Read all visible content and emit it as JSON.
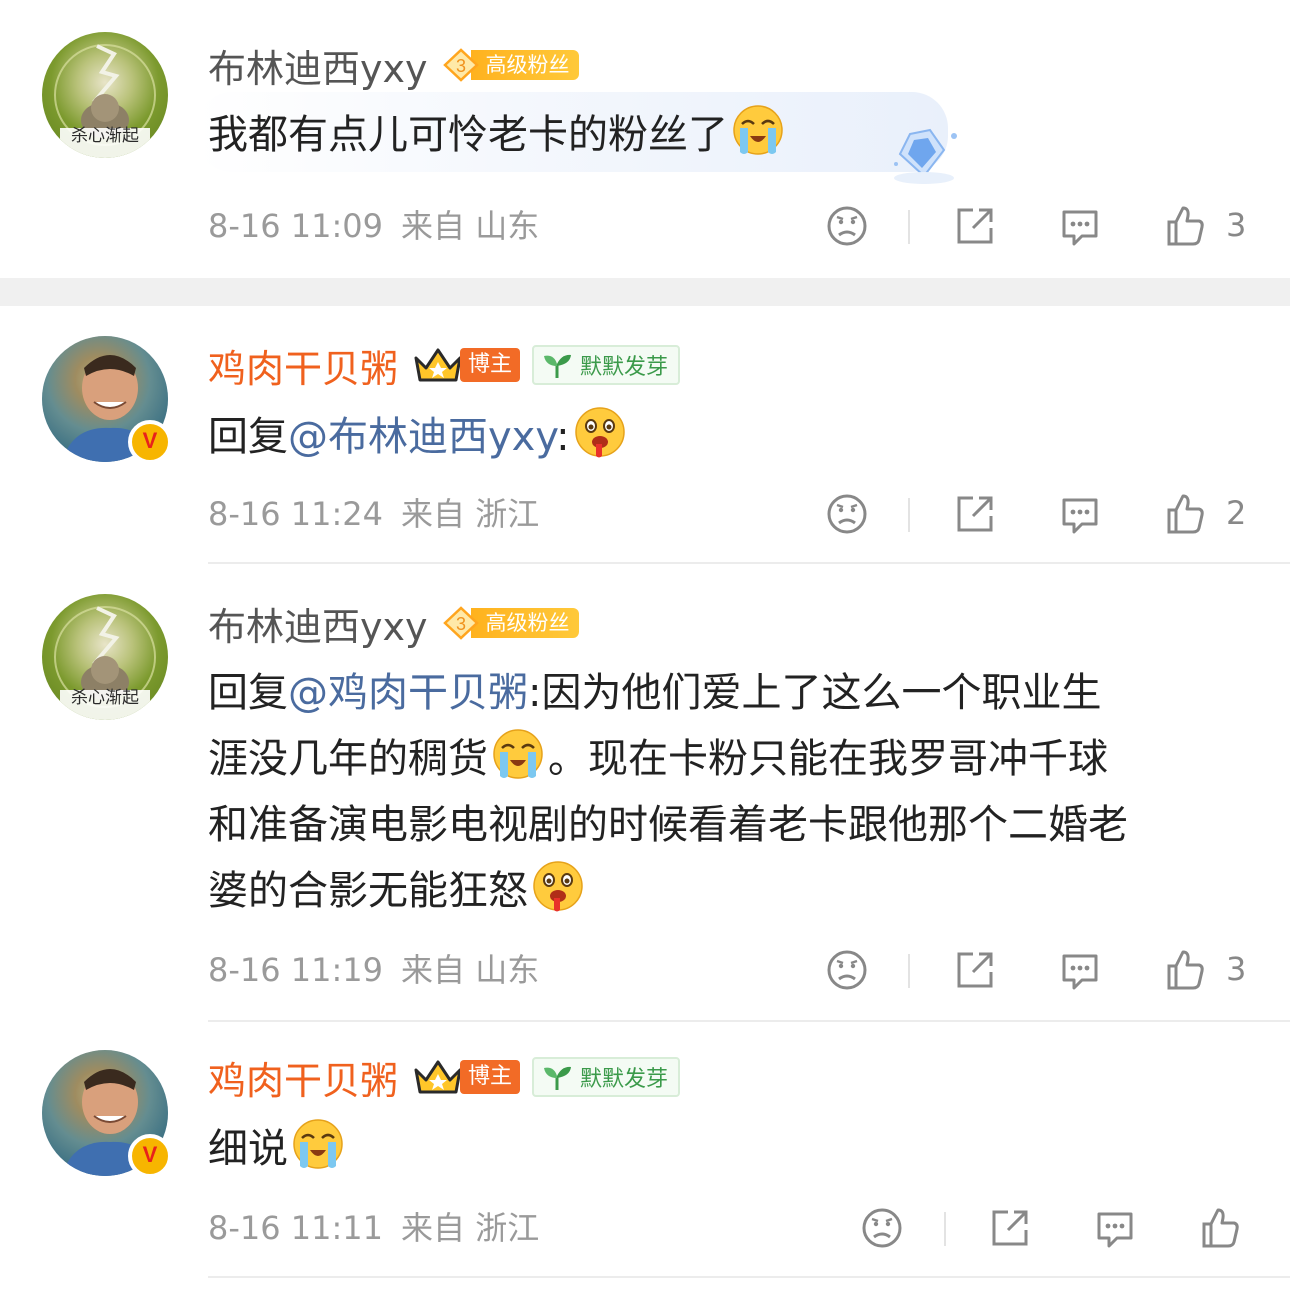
{
  "comments": [
    {
      "username": "布林迪西yxy",
      "fan_level": "3",
      "fan_label": "高级粉丝",
      "avatar_caption": "杀心渐起",
      "text": "我都有点儿可怜老卡的粉丝了",
      "emoji": "crying-face-emoji",
      "time": "8-16 11:09",
      "location": "来自 山东",
      "likes": "3"
    },
    {
      "username": "鸡肉干贝粥",
      "badge_blogger": "博主",
      "badge_sprout": "默默发芽",
      "reply_prefix": "回复",
      "reply_to": "@布林迪西yxy",
      "text": ":",
      "emoji": "drooling-face-emoji",
      "time": "8-16 11:24",
      "location": "来自 浙江",
      "likes": "2"
    },
    {
      "username": "布林迪西yxy",
      "fan_level": "3",
      "fan_label": "高级粉丝",
      "avatar_caption": "杀心渐起",
      "reply_prefix": "回复",
      "reply_to": "@鸡肉干贝粥",
      "text_line1": ":因为他们爱上了这么一个职业生",
      "text_line2a": "涯没几年的稠货",
      "text_line2b": "。现在卡粉只能在我罗哥冲千球",
      "text_line3": "和准备演电影电视剧的时候看着老卡跟他那个二婚老",
      "text_line4": "婆的合影无能狂怒",
      "time": "8-16 11:19",
      "location": "来自 山东",
      "likes": "3"
    },
    {
      "username": "鸡肉干贝粥",
      "badge_blogger": "博主",
      "badge_sprout": "默默发芽",
      "text": "细说",
      "time": "8-16 11:11",
      "location": "来自 浙江",
      "likes": ""
    }
  ],
  "colors": {
    "username_fan": "#555555",
    "username_blogger": "#f0611e",
    "mention": "#4a6b9f",
    "meta": "#9a9a9a"
  },
  "icons": [
    "sad-face-icon",
    "share-icon",
    "comment-icon",
    "like-icon"
  ]
}
